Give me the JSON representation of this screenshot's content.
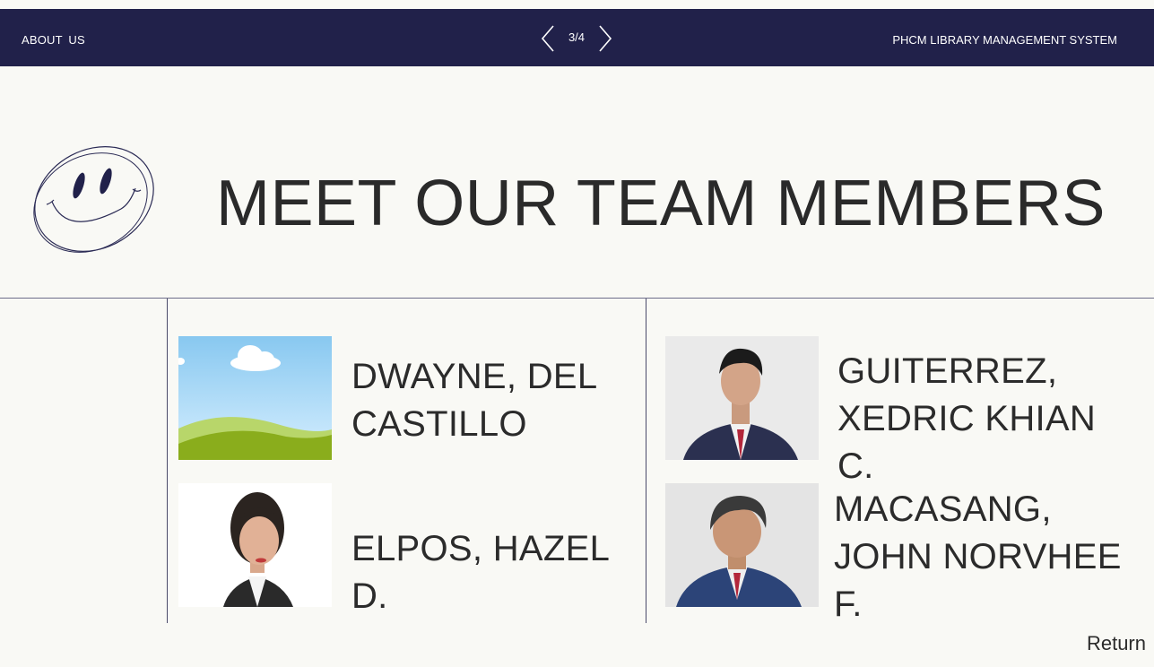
{
  "header": {
    "about_label": "ABOUT US",
    "page_indicator": "3/4",
    "system_name": "PHCM LIBRARY MANAGEMENT SYSTEM"
  },
  "main": {
    "title": "MEET OUR TEAM MEMBERS",
    "members": [
      {
        "name": "DWAYNE, DEL CASTILLO",
        "photo": "landscape-placeholder"
      },
      {
        "name": "ELPOS, HAZEL D.",
        "photo": "portrait-photo"
      },
      {
        "name": "GUITERREZ, XEDRIC KHIAN C.",
        "photo": "portrait-photo"
      },
      {
        "name": "MACASANG, JOHN NORVHEE F.",
        "photo": "portrait-photo"
      }
    ]
  },
  "footer": {
    "return_label": "Return"
  },
  "colors": {
    "header_bg": "#21214a",
    "page_bg": "#f9f9f5",
    "text": "#2b2b2b"
  }
}
